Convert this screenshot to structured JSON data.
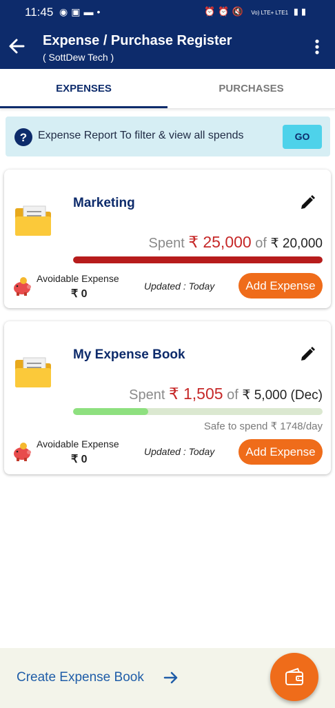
{
  "status_bar": {
    "time": "11:45",
    "network": "Vo) LTE+ LTE1"
  },
  "header": {
    "title": "Expense / Purchase Register",
    "subtitle": "( SottDew Tech )"
  },
  "tabs": [
    {
      "label": "EXPENSES",
      "active": true
    },
    {
      "label": "PURCHASES",
      "active": false
    }
  ],
  "banner": {
    "text": "Expense Report To filter & view all spends",
    "button": "GO"
  },
  "books": [
    {
      "name": "Marketing",
      "spent_label": "Spent",
      "spent": "₹ 25,000",
      "of_label": "of",
      "budget": "₹ 20,000",
      "progress": 1.0,
      "bar_color": "#b71c1c",
      "safe_text": "",
      "avoidable_label": "Avoidable Expense",
      "avoidable_value": "₹ 0",
      "updated": "Updated : Today",
      "add_button": "Add Expense"
    },
    {
      "name": "My Expense Book",
      "spent_label": "Spent",
      "spent": "₹ 1,505",
      "of_label": "of",
      "budget": "₹ 5,000 (Dec)",
      "progress": 0.3,
      "bar_color": "#8ee07f",
      "safe_text": "Safe to spend ₹ 1748/day",
      "avoidable_label": "Avoidable Expense",
      "avoidable_value": "₹ 0",
      "updated": "Updated : Today",
      "add_button": "Add Expense"
    }
  ],
  "footer": {
    "create_label": "Create Expense Book"
  },
  "colors": {
    "primary": "#0d2b6b",
    "accent": "#ef6c1a",
    "over_budget": "#b71c1c",
    "banner_bg": "#d6eef4"
  }
}
